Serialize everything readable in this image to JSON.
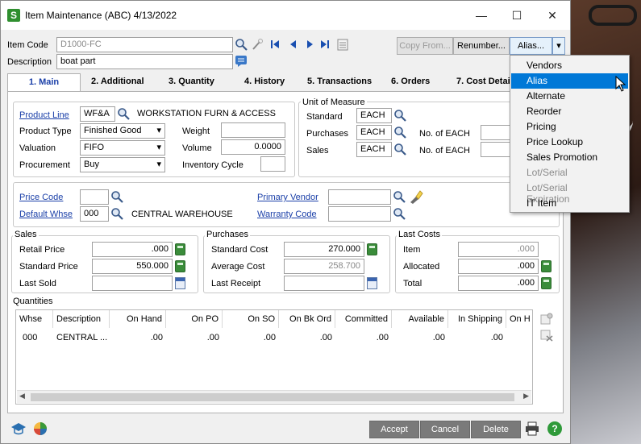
{
  "window": {
    "title": "Item Maintenance (ABC) 4/13/2022",
    "app_icon": "S",
    "minimize": "—",
    "maximize": "☐",
    "close": "✕"
  },
  "header": {
    "item_code_label": "Item Code",
    "item_code_value": "D1000-FC",
    "description_label": "Description",
    "description_value": "boat part",
    "copy_from_label": "Copy From...",
    "renumber_label": "Renumber...",
    "alias_label": "Alias...",
    "alias_dropdown": "▾"
  },
  "tabs": [
    {
      "label": "1. Main"
    },
    {
      "label": "2. Additional"
    },
    {
      "label": "3. Quantity"
    },
    {
      "label": "4. History"
    },
    {
      "label": "5. Transactions"
    },
    {
      "label": "6. Orders"
    },
    {
      "label": "7. Cost Detail"
    }
  ],
  "main": {
    "product_line_label": "Product Line",
    "product_line_value": "WF&A",
    "product_line_desc": "WORKSTATION FURN & ACCESS",
    "product_type_label": "Product Type",
    "product_type_value": "Finished Good",
    "valuation_label": "Valuation",
    "valuation_value": "FIFO",
    "procurement_label": "Procurement",
    "procurement_value": "Buy",
    "weight_label": "Weight",
    "weight_value": "",
    "volume_label": "Volume",
    "volume_value": "0.0000",
    "inventory_cycle_label": "Inventory Cycle",
    "inventory_cycle_value": "",
    "uom_title": "Unit of Measure",
    "standard_label": "Standard",
    "standard_value": "EACH",
    "purchases_label": "Purchases",
    "purchases_value": "EACH",
    "sales_label": "Sales",
    "sales_value": "EACH",
    "no_of_each_label": "No. of EACH",
    "price_code_label": "Price Code",
    "price_code_value": "",
    "default_whse_label": "Default Whse",
    "default_whse_value": "000",
    "default_whse_desc": "CENTRAL WAREHOUSE",
    "primary_vendor_label": "Primary Vendor",
    "primary_vendor_value": "",
    "warranty_code_label": "Warranty Code",
    "warranty_code_value": ""
  },
  "sales": {
    "title": "Sales",
    "retail_price_label": "Retail Price",
    "retail_price_value": ".000",
    "standard_price_label": "Standard Price",
    "standard_price_value": "550.000",
    "last_sold_label": "Last Sold",
    "last_sold_value": ""
  },
  "purchases": {
    "title": "Purchases",
    "standard_cost_label": "Standard Cost",
    "standard_cost_value": "270.000",
    "average_cost_label": "Average Cost",
    "average_cost_value": "258.700",
    "last_receipt_label": "Last Receipt",
    "last_receipt_value": ""
  },
  "last_costs": {
    "title": "Last Costs",
    "item_label": "Item",
    "item_value": ".000",
    "allocated_label": "Allocated",
    "allocated_value": ".000",
    "total_label": "Total",
    "total_value": ".000"
  },
  "quantities": {
    "title": "Quantities",
    "columns": [
      "Whse",
      "Description",
      "On Hand",
      "On PO",
      "On SO",
      "On Bk Ord",
      "Committed",
      "Available",
      "In Shipping",
      "On H"
    ],
    "rows": [
      [
        "000",
        "CENTRAL ...",
        ".00",
        ".00",
        ".00",
        ".00",
        ".00",
        ".00",
        ".00",
        ""
      ]
    ],
    "scroll_left": "◀",
    "scroll_right": "▶"
  },
  "footer": {
    "accept_label": "Accept",
    "cancel_label": "Cancel",
    "delete_label": "Delete",
    "help_label": "?"
  },
  "alias_menu": {
    "items": [
      {
        "label": "Vendors",
        "state": "normal"
      },
      {
        "label": "Alias",
        "state": "selected"
      },
      {
        "label": "Alternate",
        "state": "normal"
      },
      {
        "label": "Reorder",
        "state": "normal"
      },
      {
        "label": "Pricing",
        "state": "normal"
      },
      {
        "label": "Price Lookup",
        "state": "normal"
      },
      {
        "label": "Sales Promotion",
        "state": "normal"
      },
      {
        "label": "Lot/Serial",
        "state": "disabled"
      },
      {
        "label": "Lot/Serial Expiration",
        "state": "disabled"
      },
      {
        "label": "IT Item",
        "state": "normal"
      }
    ]
  },
  "colors": {
    "accent": "#0078d7",
    "link": "#1a3fa8",
    "app_icon": "#2f8f2f"
  }
}
